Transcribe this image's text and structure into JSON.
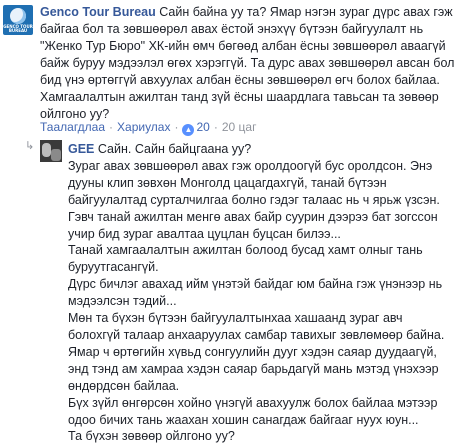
{
  "comment1": {
    "author": "Genco Tour Bureau",
    "avatar_brand": "GENCO TOUR BUREAU",
    "text": "Сайн байна уу та? Ямар нэгэн зураг дүрс авах гэж байгаа бол та зөвшөөрөл авах ёстой энэхүү бүтээн байгуулалт нь \"Женко Тур Бюро\" ХК-ийн өмч бөгөөд албан ёсны зөвшөөрөл аваагүй байж буруу мэдээлэл өгөх хэрэггүй. Та дурс авах зөвшөөрөл авсан бол бид үнэ өртөггүй авхуулах албан ёсны зөвшөөрөл өгч болох байлаа. Хамгаалалтын ажилтан танд зүй ёсны шаардлага тавьсан та зөвөөр ойлгоно уу?",
    "actions": {
      "like": "Таалагдлаа",
      "reply": "Хариулах",
      "likes": "20",
      "time": "20 цаг",
      "separator": "·"
    }
  },
  "reply": {
    "author": "GEE",
    "paragraphs": [
      "Сайн. Сайн байцгаана уу?",
      "Зураг авах зөвшөөрөл авах гэж оролдоогүй бус оролдсон. Энэ дууны клип зөвхөн Монголд цацагдахгүй, танай бүтээн байгуулалтад сурталчилгаа болно гэдэг талаас нь ч ярьж үзсэн. Гэвч танай ажилтан менгө авах байр суурин дээрээ бат зогссон учир бид зураг авалтаа цуцлан буцсан билээ...",
      "Танай хамгаалалтын ажилтан болоод бусад хамт олныг тань буруутгасангүй.",
      "Дүрс бичлэг авахад ийм үнэтэй байдаг юм байна гэж үнэнээр нь мэдээлсэн тэдий...",
      "Мөн та бүхэн бүтээн байгуулалтынхаа хашаанд зураг авч болохгүй талаар анхааруулах самбар тавихыг зөвлөмөөр байна. Ямар ч өртөгийн хүвьд сонгуулийн дууг хэдэн саяар дуудаагүй, энд тэнд ам хамраа хэдэн саяар барьдагүй мань мэтэд үнэхээр өндөрдсөн байлаа.",
      "Бүх зүйл өнгөрсөн хойно үнэгүй авахуулж болох байлаа мэтээр одоо бичих тань жаахан хошин санагдаж байгааг нуух юун...",
      "Та бүхэн зөвөөр ойлгоно уу?"
    ]
  }
}
